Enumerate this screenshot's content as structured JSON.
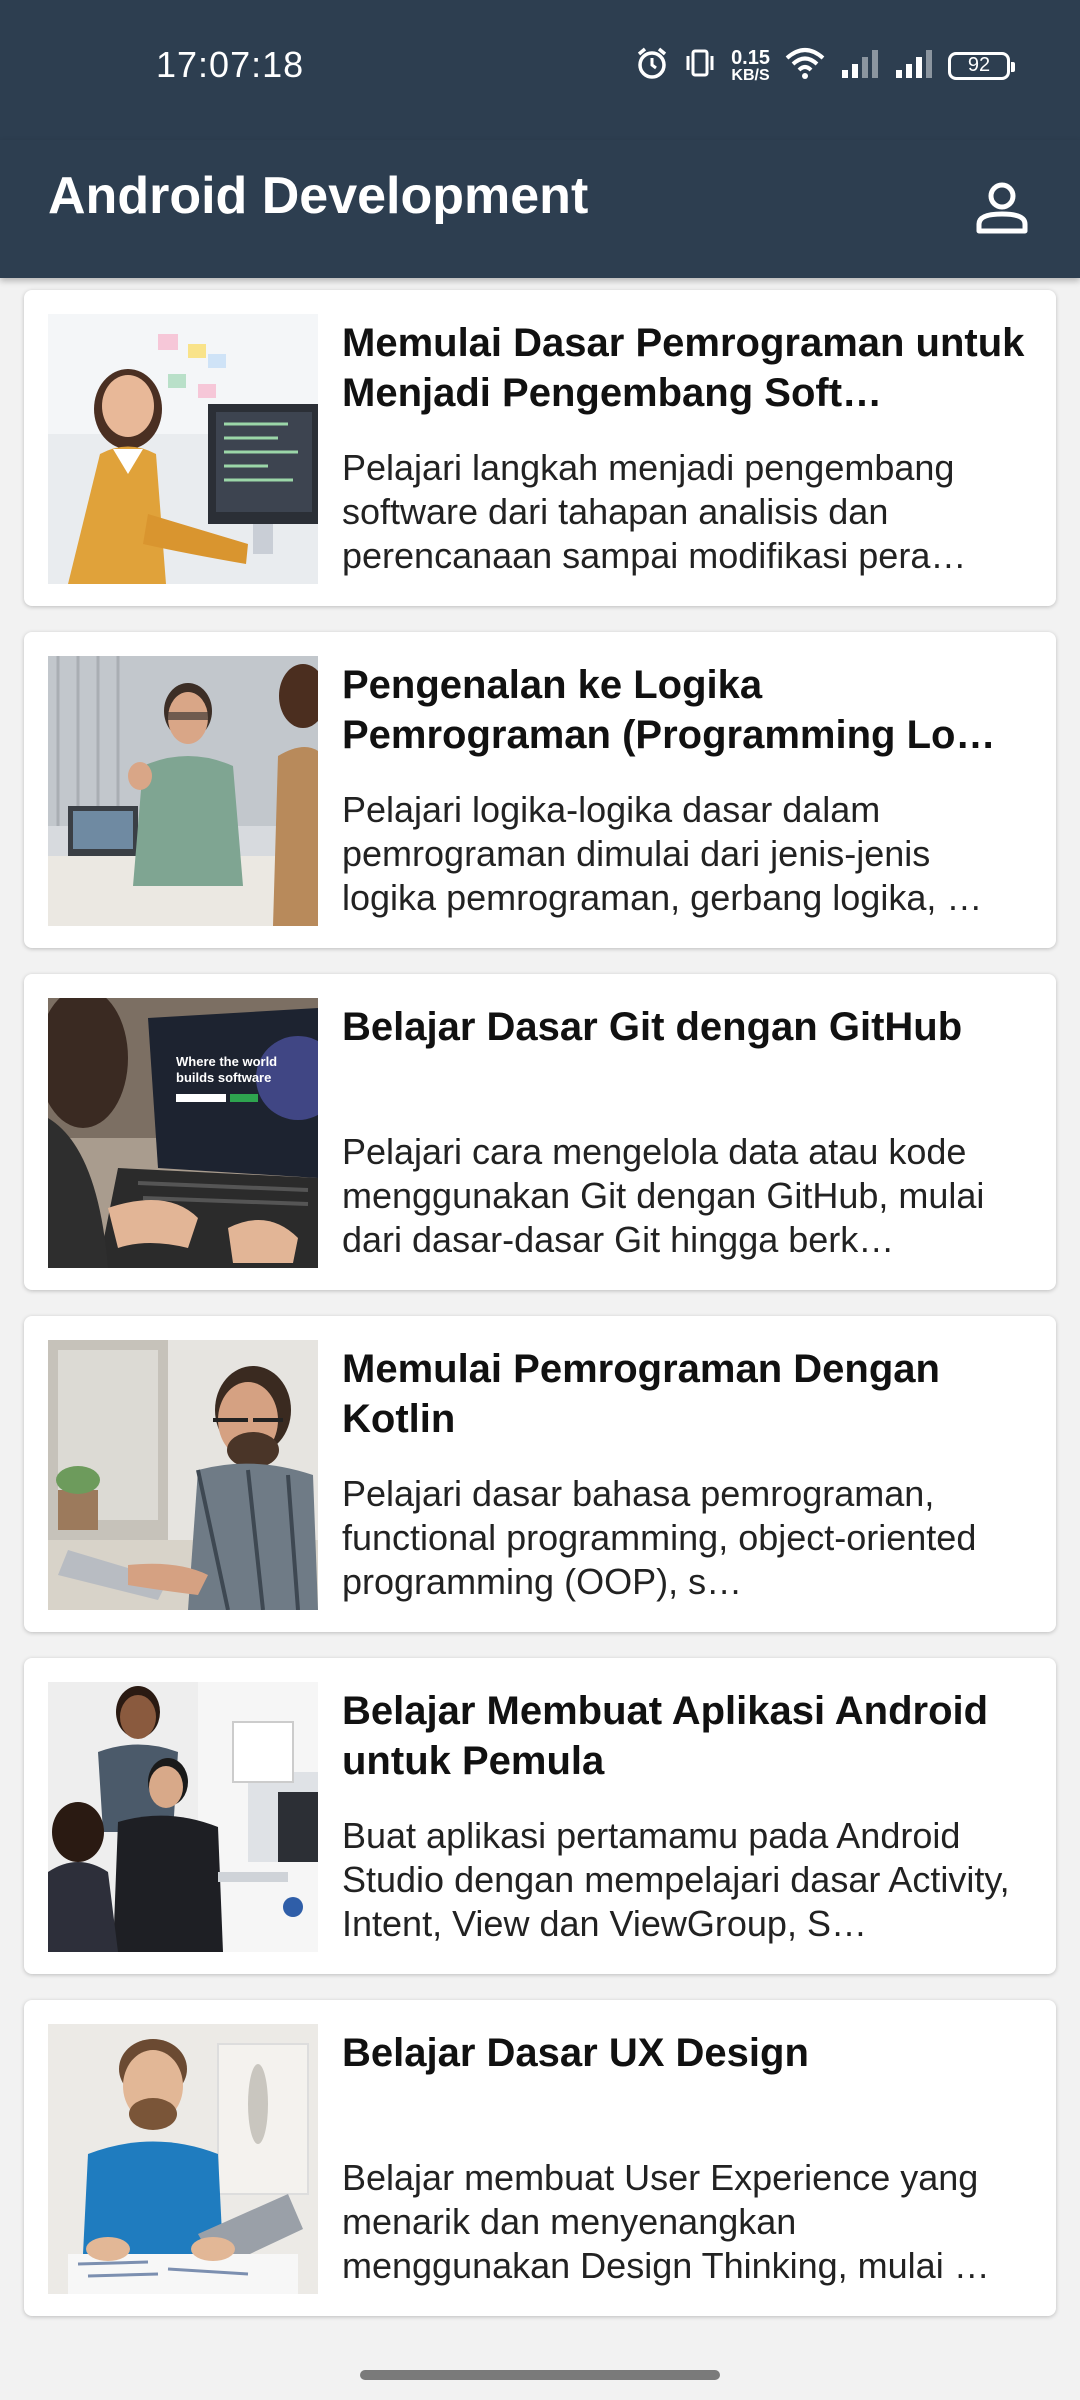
{
  "status_bar": {
    "time": "17:07:18",
    "net_speed_value": "0.15",
    "net_speed_unit": "KB/S",
    "battery": "92",
    "icons": [
      "alarm-icon",
      "vibrate-icon",
      "wifi-icon",
      "signal-icon",
      "signal-icon",
      "battery-icon"
    ]
  },
  "app_bar": {
    "title": "Android Development",
    "profile_icon": "person-icon"
  },
  "courses": [
    {
      "title": "Memulai Dasar Pemrograman untuk Menjadi Pengembang Soft…",
      "description": "Pelajari langkah menjadi pengembang software dari tahapan analisis dan perencanaan sampai modifikasi pera…"
    },
    {
      "title": "Pengenalan ke Logika Pemrograman (Programming Lo…",
      "description": "Pelajari logika-logika dasar dalam pemrograman dimulai dari jenis-jenis logika pemrograman, gerbang logika, …"
    },
    {
      "title": "Belajar Dasar Git dengan GitHub",
      "description": "Pelajari cara mengelola data atau kode menggunakan Git dengan GitHub, mulai dari dasar-dasar Git hingga berk…"
    },
    {
      "title": "Memulai Pemrograman Dengan Kotlin",
      "description": "Pelajari dasar bahasa pemrograman, functional programming, object-oriented programming (OOP), s…"
    },
    {
      "title": "Belajar Membuat Aplikasi Android untuk Pemula",
      "description": "Buat aplikasi pertamamu pada Android Studio dengan mempelajari dasar Activity, Intent, View dan ViewGroup, S…"
    },
    {
      "title": "Belajar Dasar UX Design",
      "description": "Belajar membuat User Experience yang menarik dan menyenangkan menggunakan Design Thinking, mulai …"
    }
  ],
  "thumbnail_texts": {
    "github_laptop_line1": "Where the world",
    "github_laptop_line2": "builds software"
  },
  "colors": {
    "app_bar": "#2d3e50",
    "background": "#f2f2f2",
    "card": "#ffffff"
  }
}
